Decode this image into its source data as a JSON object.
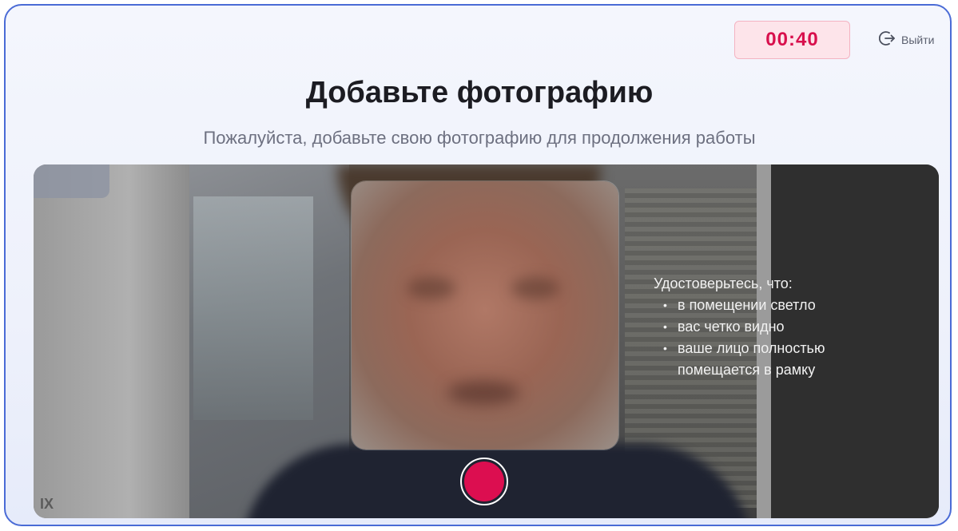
{
  "header": {
    "timer": "00:40",
    "exit_label": "Выйти"
  },
  "main": {
    "title": "Добавьте фотографию",
    "subtitle": "Пожалуйста, добавьте свою фотографию для продолжения работы"
  },
  "camera": {
    "tips_heading": "Удостоверьтесь, что:",
    "tips": [
      "в помещении светло",
      "вас четко видно",
      "ваше лицо полностью помещается в рамку"
    ],
    "watermark": "IX"
  },
  "colors": {
    "accent": "#dc0e50",
    "timer_bg": "#fde4ea",
    "frame_border": "#4a6bd6"
  },
  "icons": {
    "exit": "logout-arrow-icon",
    "shutter": "capture-button"
  }
}
